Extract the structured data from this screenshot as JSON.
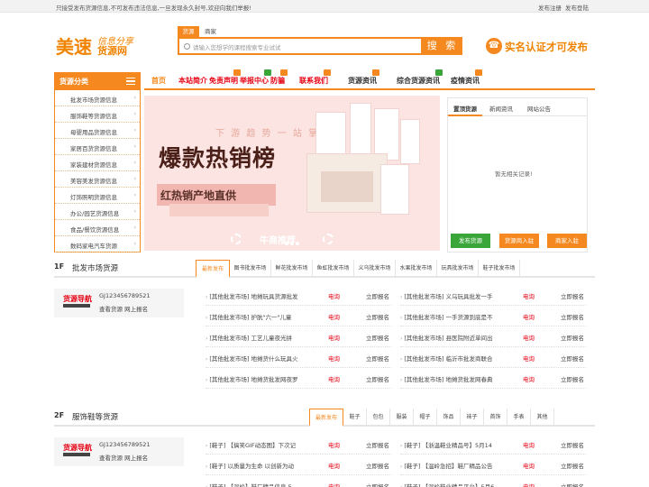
{
  "topbar": {
    "notice": "只接受发布货源信息,不可发布违法信息,一旦发现永久封号,欢迎向我们举报!",
    "register": "发布注册",
    "login": "发布登陆"
  },
  "logo": {
    "brand": "美速",
    "script": "信息分享",
    "name": "货源网"
  },
  "search": {
    "tabs": [
      "货源",
      "商家"
    ],
    "placeholder": "请输入您想学的课程搜索专业试试",
    "button": "搜 索"
  },
  "slogan": "实名认证才可发布",
  "nav": {
    "items": [
      "首页",
      "本站简介",
      "免责声明",
      "举报中心",
      "防骗",
      "联系我们",
      "货源资讯",
      "综合货源资讯",
      "疫情资讯"
    ],
    "badges": [
      "",
      "",
      "HOT",
      "NEW",
      "HOT",
      "HOT",
      "HOT",
      "NEW",
      "HOT"
    ]
  },
  "categories": {
    "title": "货源分类",
    "items": [
      "批发市场货源信息",
      "服饰鞋等货源信息",
      "母婴用品货源信息",
      "家居百货货源信息",
      "家装建材货源信息",
      "美容美发货源信息",
      "灯饰照明货源信息",
      "办公/园艺货源信息",
      "食品/餐饮货源信息",
      "数码家电汽车货源"
    ]
  },
  "banner": {
    "line1": "下 游 趋 势 一 站 掌 握",
    "headline": "爆款热销榜",
    "sub": "红热销产地直供",
    "footer": "牛商推荐"
  },
  "rpanel": {
    "tabs": [
      "置顶货源",
      "新闻资讯",
      "网站公告"
    ],
    "empty": "暂无相关记录!",
    "buttons": [
      "发布货源",
      "货源商入驻",
      "商家入驻"
    ],
    "button_colors": [
      "#3aa63a",
      "#f5891f",
      "#f5891f"
    ]
  },
  "floors": [
    {
      "num": "1F",
      "title": "批发市场货源",
      "tabs": [
        "最新发布",
        "图书批发市场",
        "鲜花批发市场",
        "鱼虹批发市场",
        "义乌批发市场",
        "水果批发市场",
        "玩具批发市场",
        "鞋子批发市场"
      ],
      "card": {
        "id": "GJ123456789521",
        "links": "查看货源 网上报名"
      },
      "left": [
        "[其他批发市场] 地摊玩具货源批发",
        "[其他批发市场] 护肮\"六一\"儿童",
        "[其他批发市场] 工艺儿童夜光拼",
        "[其他批发市场] 地摊货什么玩具火",
        "[其他批发市场] 地摊货批发网夜罗"
      ],
      "right": [
        "[其他批发市场] 义乌玩具批发一手",
        "[其他批发市场] 一手货源到底是不",
        "[其他批发市场] 县医院附近单间出",
        "[其他批发市场] 临沂市批发商联合",
        "[其他批发市场] 地摊货批发网春典"
      ],
      "price": "电询",
      "apply": "立即报名"
    },
    {
      "num": "2F",
      "title": "服饰鞋等货源",
      "tabs": [
        "最新发布",
        "鞋子",
        "包包",
        "服装",
        "帽子",
        "饰品",
        "袜子",
        "首饰",
        "手表",
        "其他"
      ],
      "card": {
        "id": "GJ123456789521",
        "links": "查看货源 网上报名"
      },
      "left": [
        "[鞋子] 【搞笑GIF动态图】下次记",
        "[鞋子] 以质量为生命 以创新为动",
        "[鞋子] 【温岭】鞋厂精品信息 5"
      ],
      "right": [
        "[鞋子] 【浙温鞋业精品号】5月14",
        "[鞋子] 【温岭急招】鞋厂精品公告",
        "[鞋子] 【温岭鞋业精品平台】5月6"
      ],
      "price": "电询",
      "apply": "立即报名"
    }
  ]
}
